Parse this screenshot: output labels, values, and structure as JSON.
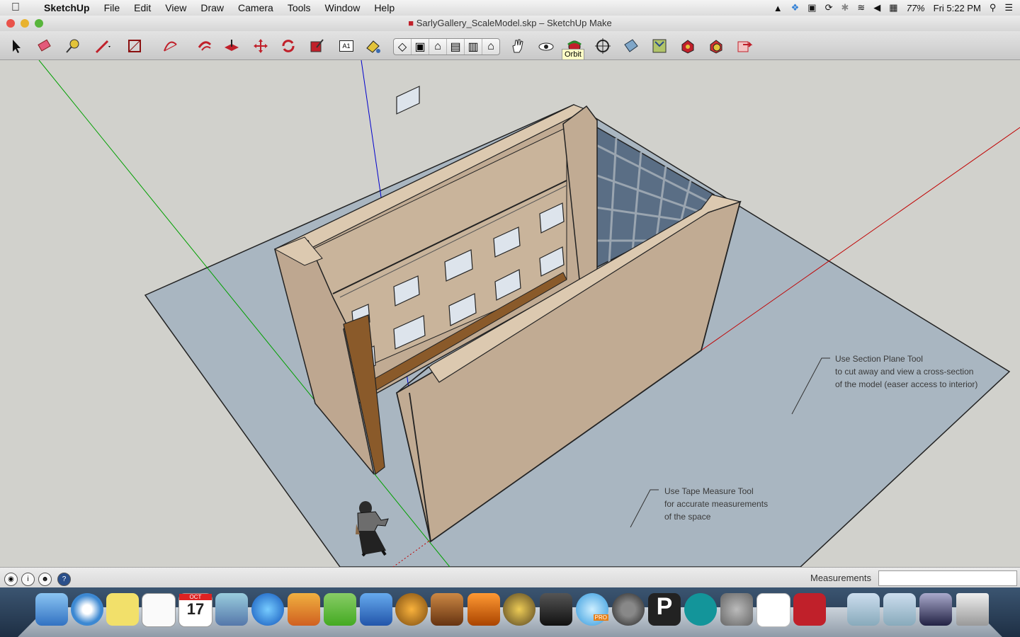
{
  "menubar": {
    "app_name": "SketchUp",
    "items": [
      "File",
      "Edit",
      "View",
      "Draw",
      "Camera",
      "Tools",
      "Window",
      "Help"
    ],
    "battery": "77%",
    "clock": "Fri 5:22 PM"
  },
  "window": {
    "title": "SarlyGallery_ScaleModel.skp – SketchUp Make"
  },
  "toolbar": {
    "tools": [
      "select",
      "eraser",
      "tape-measure",
      "pencil",
      "rectangle",
      "arc",
      "paint-bucket",
      "push-pull",
      "move",
      "rotate",
      "scale",
      "text",
      "paint",
      "views",
      "pan",
      "look-around",
      "orbit",
      "walk",
      "position-camera",
      "section-plane",
      "3d-warehouse",
      "components",
      "extension-warehouse",
      "export"
    ],
    "tooltip": "Orbit",
    "text_tool_label": "A1"
  },
  "canvas": {
    "annotations": [
      {
        "lines": [
          "Use Section Plane Tool",
          "to cut away and view a cross-section",
          "of the model (easer access to interior)"
        ]
      },
      {
        "lines": [
          "Use Tape Measure Tool",
          "for accurate measurements",
          "of the space"
        ]
      }
    ],
    "colors": {
      "ground": "#a9b6c1",
      "wall": "#c1ab93",
      "wall_top": "#dcc9b0",
      "sky": "#d1d1cc",
      "axis_red": "#c00000",
      "axis_green": "#00a000",
      "axis_blue": "#0000cc",
      "glass": "#5a6e85",
      "floor_wood": "#8a5a2a"
    }
  },
  "statusbar": {
    "measurements_label": "Measurements",
    "measurements_value": ""
  },
  "dock": {
    "calendar_day": "17",
    "calendar_month": "OCT",
    "pro_badge": "PRO"
  }
}
